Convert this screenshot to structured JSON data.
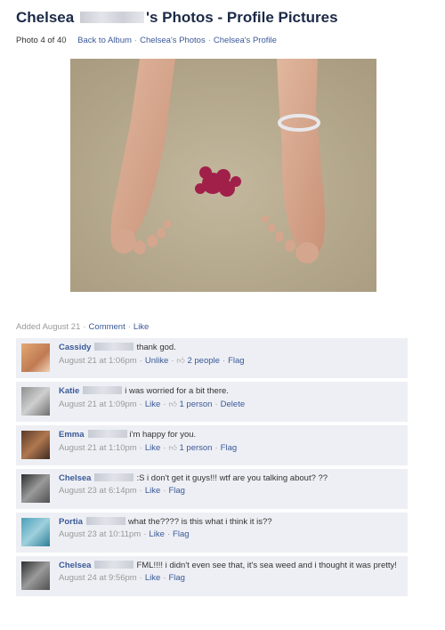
{
  "header": {
    "owner_first": "Chelsea",
    "title_suffix": "'s Photos - Profile Pictures"
  },
  "subnav": {
    "position": "Photo 4 of 40",
    "back": "Back to Album",
    "owner_photos": "Chelsea's Photos",
    "owner_profile": "Chelsea's Profile"
  },
  "photo": {
    "alt": "bare feet on sand with red seaweed"
  },
  "added_bar": {
    "added": "Added August 21",
    "comment": "Comment",
    "like": "Like"
  },
  "comments": [
    {
      "name": "Cassidy",
      "text": "thank god.",
      "time": "August 21 at 1:06pm",
      "action": "Unlike",
      "likes": "2 people",
      "end": "Flag"
    },
    {
      "name": "Katie",
      "text": "i was worried for a bit there.",
      "time": "August 21 at 1:09pm",
      "action": "Like",
      "likes": "1 person",
      "end": "Delete"
    },
    {
      "name": "Emma",
      "text": "i'm happy for you.",
      "time": "August 21 at 1:10pm",
      "action": "Like",
      "likes": "1 person",
      "end": "Flag"
    },
    {
      "name": "Chelsea",
      "text": ":S i don't get it guys!!! wtf are you talking about? ??",
      "time": "August 23 at 6:14pm",
      "action": "Like",
      "likes": "",
      "end": "Flag"
    },
    {
      "name": "Portia",
      "text": "what the???? is this what i think it is??",
      "time": "August 23 at 10:11pm",
      "action": "Like",
      "likes": "",
      "end": "Flag"
    },
    {
      "name": "Chelsea",
      "text": "FML!!!! i didn't even see that, it's sea weed and i thought it was pretty!",
      "time": "August 24 at 9:56pm",
      "action": "Like",
      "likes": "",
      "end": "Flag"
    }
  ],
  "colors": {
    "link": "#3b5998",
    "comment_bg": "#edeff4",
    "title": "#1c2a47"
  }
}
